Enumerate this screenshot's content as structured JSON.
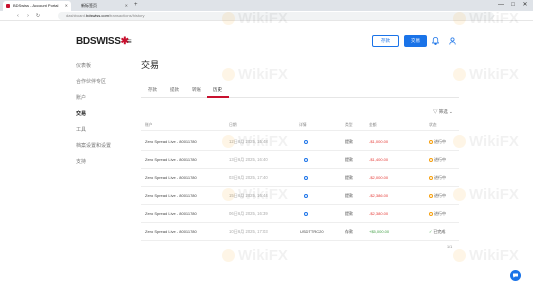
{
  "browser": {
    "tabs": [
      "BDSwiss - Account Portal",
      "新标签页"
    ],
    "url_prefix": "dashboard.",
    "url_domain": "bdswiss.com",
    "url_path": "/transactions/history",
    "window_controls": [
      "—",
      "□",
      "✕"
    ],
    "nav": [
      "‹",
      "›",
      "↻"
    ]
  },
  "brand": {
    "logo_prefix": "BD",
    "logo_rest": "SWISS",
    "logo_mark": "✱",
    "menu_glyph": "≡"
  },
  "header": {
    "deposit_label": "存款",
    "trade_label": "交易",
    "bell_icon": "🔔",
    "user_icon": "👤"
  },
  "sidebar": {
    "items": [
      {
        "label": "仪表板"
      },
      {
        "label": "合作伙伴专区"
      },
      {
        "label": "账户"
      },
      {
        "label": "交易",
        "active": true
      },
      {
        "label": "工具"
      },
      {
        "label": "档案设置和设置"
      },
      {
        "label": "支持"
      }
    ]
  },
  "main": {
    "title": "交易",
    "tabs": [
      {
        "label": "存款"
      },
      {
        "label": "提款"
      },
      {
        "label": "转账"
      },
      {
        "label": "历史",
        "active": true
      }
    ],
    "filter_label": "筛选"
  },
  "table": {
    "headers": [
      "账户",
      "日期",
      "详情",
      "类型",
      "金额",
      "状态"
    ],
    "rows": [
      {
        "account": "Zero Spread Live - 80011780",
        "date": "12日6月 2025, 15:48",
        "details": "",
        "type": "提款",
        "amount": "-$1,000.00",
        "status": "进行中",
        "tone": "neg",
        "icon": "clock"
      },
      {
        "account": "Zero Spread Live - 80011780",
        "date": "13日6月 2025, 16:40",
        "details": "",
        "type": "提款",
        "amount": "-$1,400.00",
        "status": "进行中",
        "tone": "neg",
        "icon": "clock"
      },
      {
        "account": "Zero Spread Live - 80011780",
        "date": "03日6月 2025, 17:40",
        "details": "",
        "type": "提款",
        "amount": "-$2,000.00",
        "status": "进行中",
        "tone": "neg",
        "icon": "clock"
      },
      {
        "account": "Zero Spread Live - 80011780",
        "date": "15日6月 2025, 16:44",
        "details": "",
        "type": "提款",
        "amount": "-$2,386.00",
        "status": "进行中",
        "tone": "neg",
        "icon": "clock"
      },
      {
        "account": "Zero Spread Live - 80011780",
        "date": "06日6月 2025, 16:39",
        "details": "",
        "type": "提款",
        "amount": "-$2,380.00",
        "status": "进行中",
        "tone": "neg",
        "icon": "clock"
      },
      {
        "account": "Zero Spread Live - 80011780",
        "date": "10日6月 2025, 17:03",
        "details": "USDTTRC20",
        "type": "存款",
        "amount": "+$5,000.00",
        "status": "已完成",
        "tone": "pos",
        "icon": "check"
      }
    ]
  },
  "pager": "1/1",
  "watermark": "WikiFX",
  "colors": {
    "brand": "#c8102e",
    "accent": "#1a73e8",
    "negative": "#e53935",
    "positive": "#43a047",
    "pending": "#f59e0b"
  }
}
